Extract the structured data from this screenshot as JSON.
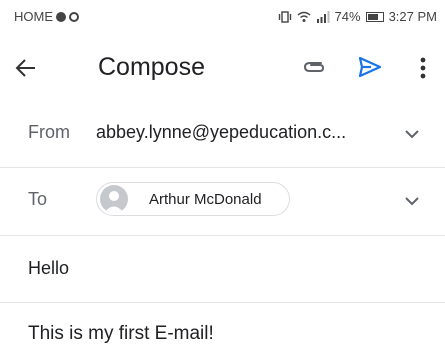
{
  "status_bar": {
    "left_label": "HOME",
    "battery_percent": "74%",
    "battery_level": 0.74,
    "time": "3:27 PM",
    "icons": [
      "chat-bubble-icon",
      "notification-icon",
      "vibrate-icon",
      "wifi-icon",
      "signal-icon",
      "battery-icon"
    ]
  },
  "app_bar": {
    "title": "Compose",
    "icons": [
      "back-arrow-icon",
      "attach-icon",
      "send-icon",
      "more-vert-icon"
    ],
    "accent_color": "#1a73e8"
  },
  "from": {
    "label": "From",
    "value": "abbey.lynne@yepeducation.c..."
  },
  "to": {
    "label": "To",
    "recipient": "Arthur McDonald"
  },
  "subject": "Hello",
  "body": "This is my first E-mail!"
}
